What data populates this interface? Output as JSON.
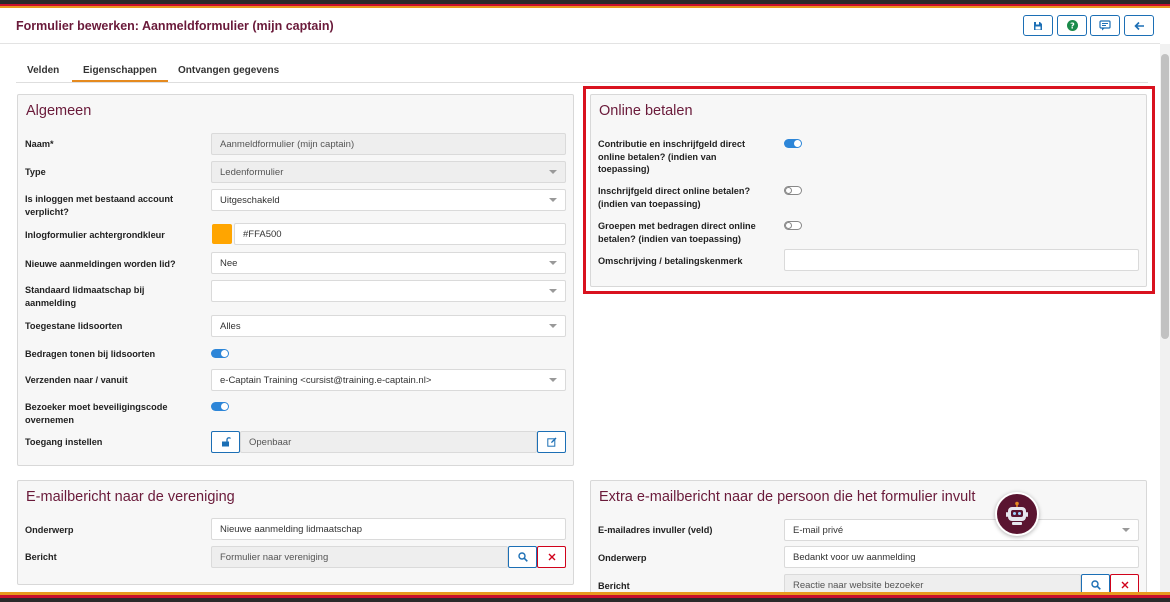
{
  "header": {
    "title": "Formulier bewerken: Aanmeldformulier (mijn captain)",
    "buttons": [
      "save-icon",
      "help-icon",
      "comment-icon",
      "back-arrow-icon"
    ]
  },
  "tabs": [
    {
      "label": "Velden",
      "active": false
    },
    {
      "label": "Eigenschappen",
      "active": true
    },
    {
      "label": "Ontvangen gegevens",
      "active": false
    }
  ],
  "algemeen": {
    "title": "Algemeen",
    "naam_label": "Naam*",
    "naam_value": "Aanmeldformulier (mijn captain)",
    "type_label": "Type",
    "type_value": "Ledenformulier",
    "inloggen_label": "Is inloggen met bestaand account verplicht?",
    "inloggen_value": "Uitgeschakeld",
    "kleur_label": "Inlogformulier achtergrondkleur",
    "kleur_value": "#FFA500",
    "nieuwe_label": "Nieuwe aanmeldingen worden lid?",
    "nieuwe_value": "Nee",
    "standaard_label": "Standaard lidmaatschap bij aanmelding",
    "standaard_value": "",
    "lidsoorten_label": "Toegestane lidsoorten",
    "lidsoorten_value": "Alles",
    "bedragen_label": "Bedragen tonen bij lidsoorten",
    "bedragen_on": true,
    "verzenden_label": "Verzenden naar / vanuit",
    "verzenden_value": "e-Captain Training <cursist@training.e-captain.nl>",
    "bezoeker_label": "Bezoeker moet beveiligingscode overnemen",
    "bezoeker_on": true,
    "toegang_label": "Toegang instellen",
    "toegang_value": "Openbaar"
  },
  "online": {
    "title": "Online betalen",
    "contributie_label": "Contributie en inschrijfgeld direct online betalen? (indien van toepassing)",
    "contributie_on": true,
    "inschrijfgeld_label": "Inschrijfgeld direct online betalen? (indien van toepassing)",
    "inschrijfgeld_on": false,
    "groepen_label": "Groepen met bedragen direct online betalen? (indien van toepassing)",
    "groepen_on": false,
    "omschrijving_label": "Omschrijving / betalingskenmerk",
    "omschrijving_value": ""
  },
  "email_vereniging": {
    "title": "E-mailbericht naar de vereniging",
    "onderwerp_label": "Onderwerp",
    "onderwerp_value": "Nieuwe aanmelding lidmaatschap",
    "bericht_label": "Bericht",
    "bericht_value": "Formulier naar vereniging"
  },
  "email_persoon": {
    "title": "Extra e-mailbericht naar de persoon die het formulier invult",
    "adres_label": "E-mailadres invuller (veld)",
    "adres_value": "E-mail privé",
    "onderwerp_label": "Onderwerp",
    "onderwerp_value": "Bedankt voor uw aanmelding",
    "bericht_label": "Bericht",
    "bericht_value": "Reactie naar website bezoeker"
  },
  "colors": {
    "accent": "#6a1a3a",
    "primary": "#1c6fb5",
    "highlight": "#d9121f",
    "tab_underline": "#e58a1f",
    "swatch": "#FFA500"
  }
}
